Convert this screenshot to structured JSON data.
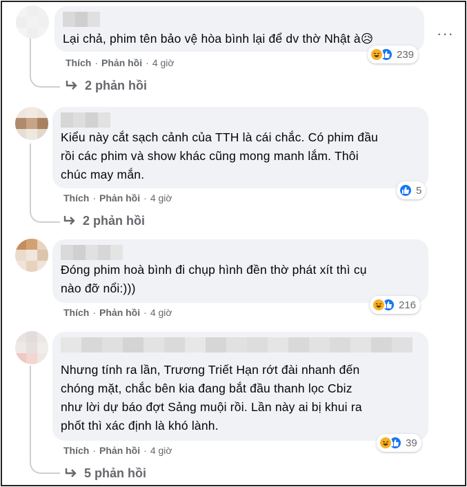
{
  "comments": [
    {
      "text_lines": [
        "Lại chả, phim tên bảo vệ hòa bình lại để dv thờ Nhật à😥"
      ],
      "like_label": "Thích",
      "reply_label": "Phản hồi",
      "time": "4 giờ",
      "reaction_count": "239",
      "reactions": [
        "haha",
        "like"
      ],
      "replies_label": "2 phản hồi"
    },
    {
      "text_lines": [
        "Kiểu này cắt sạch cảnh của TTH là cái chắc. Có phim đầu",
        "rồi các phim và show khác cũng mong manh lắm. Thôi",
        "chúc may mắn."
      ],
      "like_label": "Thích",
      "reply_label": "Phản hồi",
      "time": "4 giờ",
      "reaction_count": "5",
      "reactions": [
        "like"
      ],
      "replies_label": "2 phản hồi"
    },
    {
      "text_lines": [
        "Đóng phim hoà bình đi chụp hình đền thờ phát xít thì cụ",
        "nào đỡ nổi:)))"
      ],
      "like_label": "Thích",
      "reply_label": "Phản hồi",
      "time": "4 giờ",
      "reaction_count": "216",
      "reactions": [
        "haha",
        "like"
      ],
      "replies_label": null
    },
    {
      "text_lines": [
        "Nhưng tính ra lần, Trương Triết Hạn rớt đài nhanh đến",
        "chóng mặt, chắc bên kia đang bắt đầu thanh lọc Cbiz",
        "như lời dự báo đợt Sảng muội rồi. Lần này ai bị khui ra",
        "phốt thì xác định là khó lành."
      ],
      "like_label": "Thích",
      "reply_label": "Phản hồi",
      "time": "4 giờ",
      "reaction_count": "39",
      "reactions": [
        "haha",
        "like"
      ],
      "replies_label": "5 phản hồi"
    }
  ],
  "more_options_icon": "ellipsis-icon",
  "reply_arrow_icon": "reply-arrow-icon",
  "colors": {
    "bubble": "#f0f2f5",
    "meta": "#65676b",
    "like_blue": "#1877f2",
    "haha_yellow": "#f7b125"
  }
}
